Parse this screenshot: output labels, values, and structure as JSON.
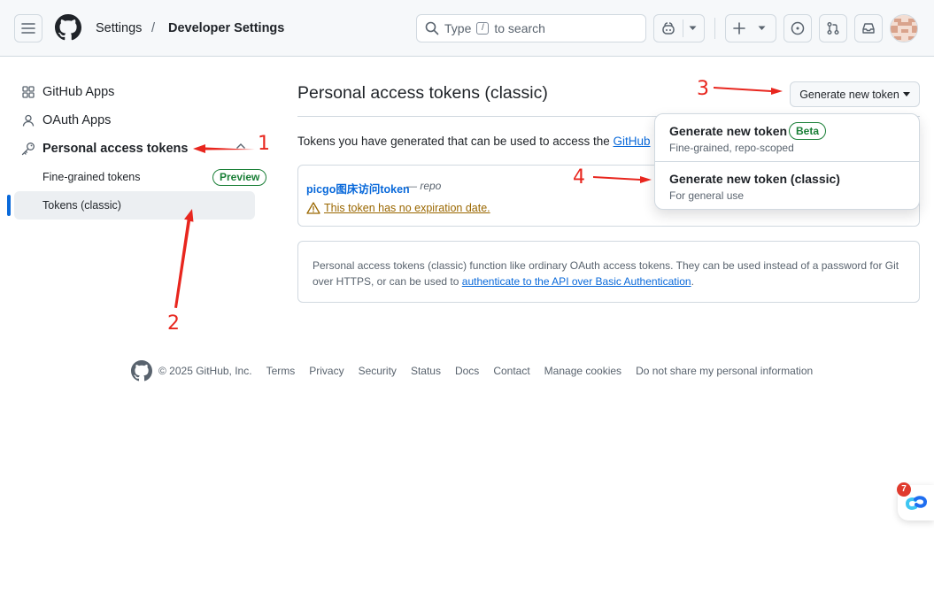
{
  "header": {
    "breadcrumb_settings": "Settings",
    "breadcrumb_separator": "/",
    "breadcrumb_current": "Developer Settings",
    "search_prefix": "Type",
    "search_key": "/",
    "search_suffix": "to search"
  },
  "sidebar": {
    "items": [
      {
        "label": "GitHub Apps",
        "icon": "apps-icon"
      },
      {
        "label": "OAuth Apps",
        "icon": "person-icon"
      },
      {
        "label": "Personal access tokens",
        "icon": "key-icon"
      }
    ],
    "subitems": [
      {
        "label": "Fine-grained tokens",
        "badge": "Preview"
      },
      {
        "label": "Tokens (classic)"
      }
    ]
  },
  "main": {
    "title": "Personal access tokens (classic)",
    "generate_button": "Generate new token",
    "intro": "Tokens you have generated that can be used to access the",
    "intro_link": "GitHub",
    "token": {
      "name": "picgo图床访问token",
      "scope": "— repo",
      "warning": "This token has no expiration date."
    },
    "info_text_1": "Personal access tokens (classic) function like ordinary OAuth access tokens. They can be used instead of a password for Git",
    "info_text_2": "over HTTPS, or can be used to",
    "info_link": "authenticate to the API over Basic Authentication",
    "info_end": "."
  },
  "dropdown": {
    "items": [
      {
        "title": "Generate new token",
        "badge": "Beta",
        "desc": "Fine-grained, repo-scoped"
      },
      {
        "title": "Generate new token (classic)",
        "desc": "For general use"
      }
    ]
  },
  "footer": {
    "copyright": "© 2025 GitHub, Inc.",
    "links": [
      "Terms",
      "Privacy",
      "Security",
      "Status",
      "Docs",
      "Contact",
      "Manage cookies",
      "Do not share my personal information"
    ]
  },
  "annotations": [
    "1",
    "2",
    "3",
    "4"
  ],
  "widget": {
    "badge": "7"
  },
  "colors": {
    "accent": "#0969da",
    "annotation": "#e8261e",
    "success": "#1a7f37",
    "warning": "#9a6700"
  }
}
